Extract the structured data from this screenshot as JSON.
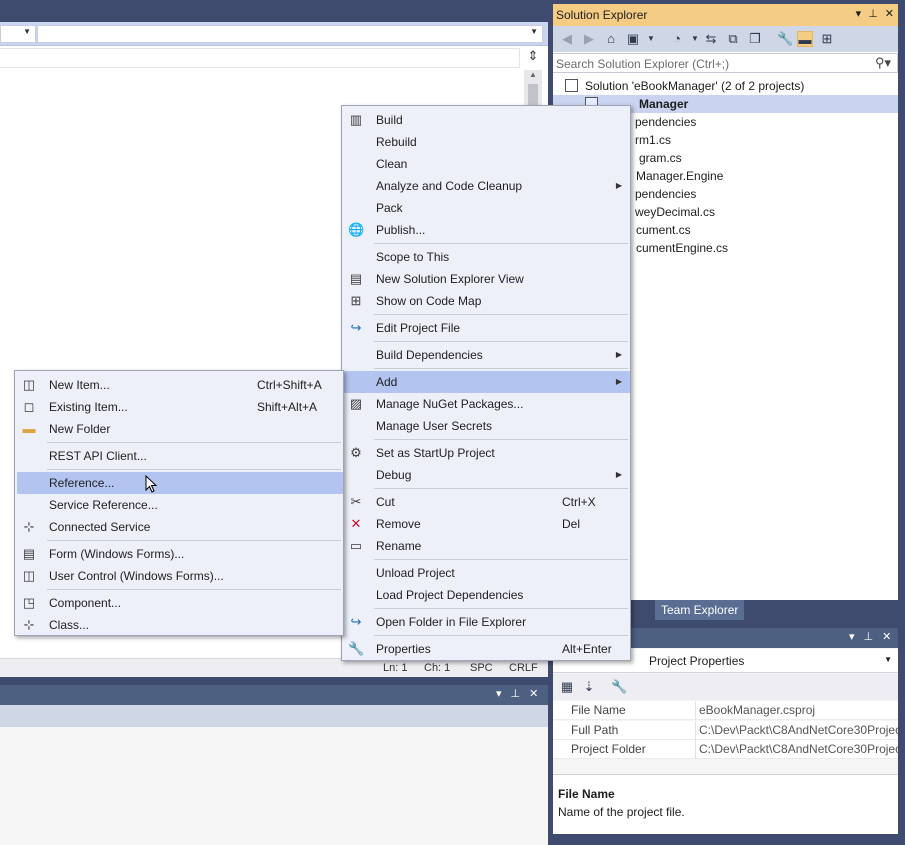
{
  "editor": {
    "status": {
      "ln": "Ln: 1",
      "ch": "Ch: 1",
      "spc": "SPC",
      "crlf": "CRLF"
    }
  },
  "solution_explorer": {
    "title": "Solution Explorer",
    "search_placeholder": "Search Solution Explorer (Ctrl+;)",
    "tree": [
      {
        "label": "Solution 'eBookManager' (2 of 2 projects)"
      },
      {
        "label": "Manager"
      },
      {
        "label": "pendencies"
      },
      {
        "label": "rm1.cs"
      },
      {
        "label": "gram.cs"
      },
      {
        "label": "Manager.Engine"
      },
      {
        "label": "pendencies"
      },
      {
        "label": "weyDecimal.cs"
      },
      {
        "label": "cument.cs"
      },
      {
        "label": "cumentEngine.cs"
      }
    ],
    "bottom_tab": "Team Explorer"
  },
  "properties": {
    "selected": "Project Properties",
    "rows": [
      {
        "key": "File Name",
        "value": "eBookManager.csproj"
      },
      {
        "key": "Full Path",
        "value": "C:\\Dev\\Packt\\C8AndNetCore30Project"
      },
      {
        "key": "Project Folder",
        "value": "C:\\Dev\\Packt\\C8AndNetCore30Project"
      }
    ],
    "desc_title": "File Name",
    "desc_text": "Name of the project file."
  },
  "context_menu": {
    "items": [
      {
        "label": "Build",
        "icon": "build-icon"
      },
      {
        "label": "Rebuild"
      },
      {
        "label": "Clean"
      },
      {
        "label": "Analyze and Code Cleanup",
        "submenu": true
      },
      {
        "label": "Pack"
      },
      {
        "label": "Publish...",
        "icon": "globe-icon"
      },
      {
        "label": "Scope to This"
      },
      {
        "label": "New Solution Explorer View",
        "icon": "new-view-icon"
      },
      {
        "label": "Show on Code Map",
        "icon": "code-map-icon"
      },
      {
        "label": "Edit Project File",
        "icon": "edit-file-icon"
      },
      {
        "label": "Build Dependencies",
        "submenu": true
      },
      {
        "label": "Add",
        "submenu": true
      },
      {
        "label": "Manage NuGet Packages...",
        "icon": "nuget-icon"
      },
      {
        "label": "Manage User Secrets"
      },
      {
        "label": "Set as StartUp Project",
        "icon": "gear-icon"
      },
      {
        "label": "Debug",
        "submenu": true
      },
      {
        "label": "Cut",
        "shortcut": "Ctrl+X",
        "icon": "cut-icon"
      },
      {
        "label": "Remove",
        "shortcut": "Del",
        "icon": "remove-icon"
      },
      {
        "label": "Rename",
        "icon": "rename-icon"
      },
      {
        "label": "Unload Project"
      },
      {
        "label": "Load Project Dependencies"
      },
      {
        "label": "Open Folder in File Explorer",
        "icon": "open-folder-icon"
      },
      {
        "label": "Properties",
        "shortcut": "Alt+Enter",
        "icon": "wrench-icon"
      }
    ]
  },
  "add_menu": {
    "items": [
      {
        "label": "New Item...",
        "shortcut": "Ctrl+Shift+A",
        "icon": "new-item-icon"
      },
      {
        "label": "Existing Item...",
        "shortcut": "Shift+Alt+A",
        "icon": "existing-item-icon"
      },
      {
        "label": "New Folder",
        "icon": "folder-icon"
      },
      {
        "label": "REST API Client..."
      },
      {
        "label": "Reference..."
      },
      {
        "label": "Service Reference..."
      },
      {
        "label": "Connected Service",
        "icon": "connected-service-icon"
      },
      {
        "label": "Form (Windows Forms)...",
        "icon": "form-icon"
      },
      {
        "label": "User Control (Windows Forms)...",
        "icon": "user-control-icon"
      },
      {
        "label": "Component...",
        "icon": "component-icon"
      },
      {
        "label": "Class...",
        "icon": "class-icon"
      }
    ]
  }
}
